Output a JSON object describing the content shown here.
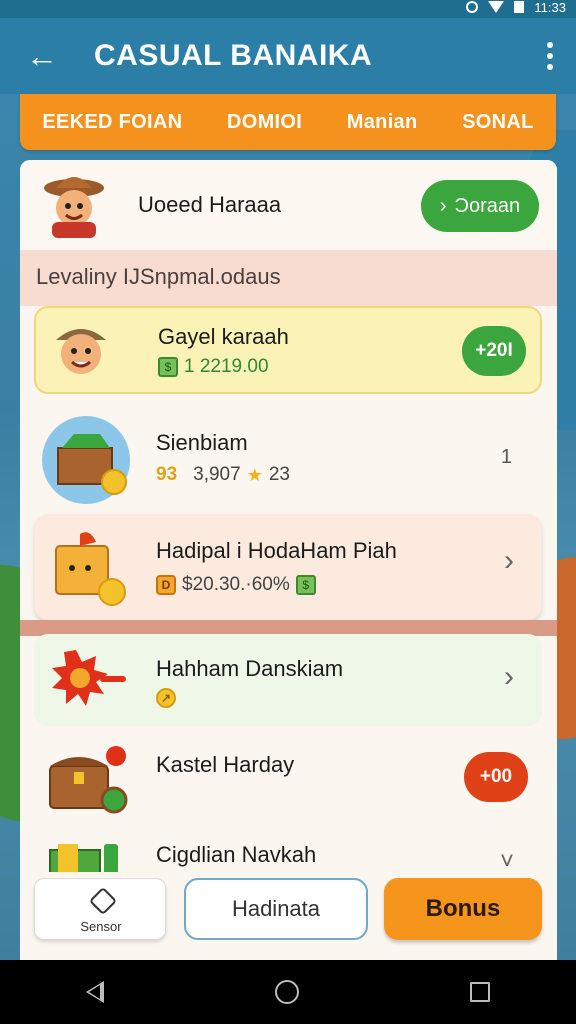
{
  "app": {
    "title": "CASUAL BANAIKA",
    "status_time": "11:33"
  },
  "tabs": [
    {
      "label": "EEKED FOIAN"
    },
    {
      "label": "DOMIOI"
    },
    {
      "label": "Manian"
    },
    {
      "label": "SONAL"
    }
  ],
  "header": {
    "name": "Uoeed Haraaa",
    "action_label": "Ɔoraan",
    "action_icon": "chevron-right-icon"
  },
  "section_label": "Levaliny IJSnpmal.odaus",
  "items": [
    {
      "title": "Gayel karaah",
      "sub_value": "1 2219.00",
      "badge": "+20I",
      "badge_color": "#3aa63d"
    },
    {
      "title": "Sienbiam",
      "sub_prefix": "93",
      "sub_value": "3,907",
      "sub_star_value": "23",
      "trailing": "1"
    },
    {
      "title": "Hadipal i HodaHam Piah",
      "sub_value": "$20.30.·60%"
    },
    {
      "title": "Hahham Danskiam"
    },
    {
      "title": "Kastel Harday",
      "badge": "+00",
      "badge_color": "#e04015"
    },
    {
      "title": "Cigdlian Navkah"
    }
  ],
  "bottom": {
    "sensor_label": "Sensor",
    "outline_label": "Hadinata",
    "bonus_label": "Bonus"
  },
  "colors": {
    "appbar": "#2b7ea6",
    "accent_orange": "#f5921d",
    "green": "#3aa63d",
    "red_badge": "#e04015"
  }
}
